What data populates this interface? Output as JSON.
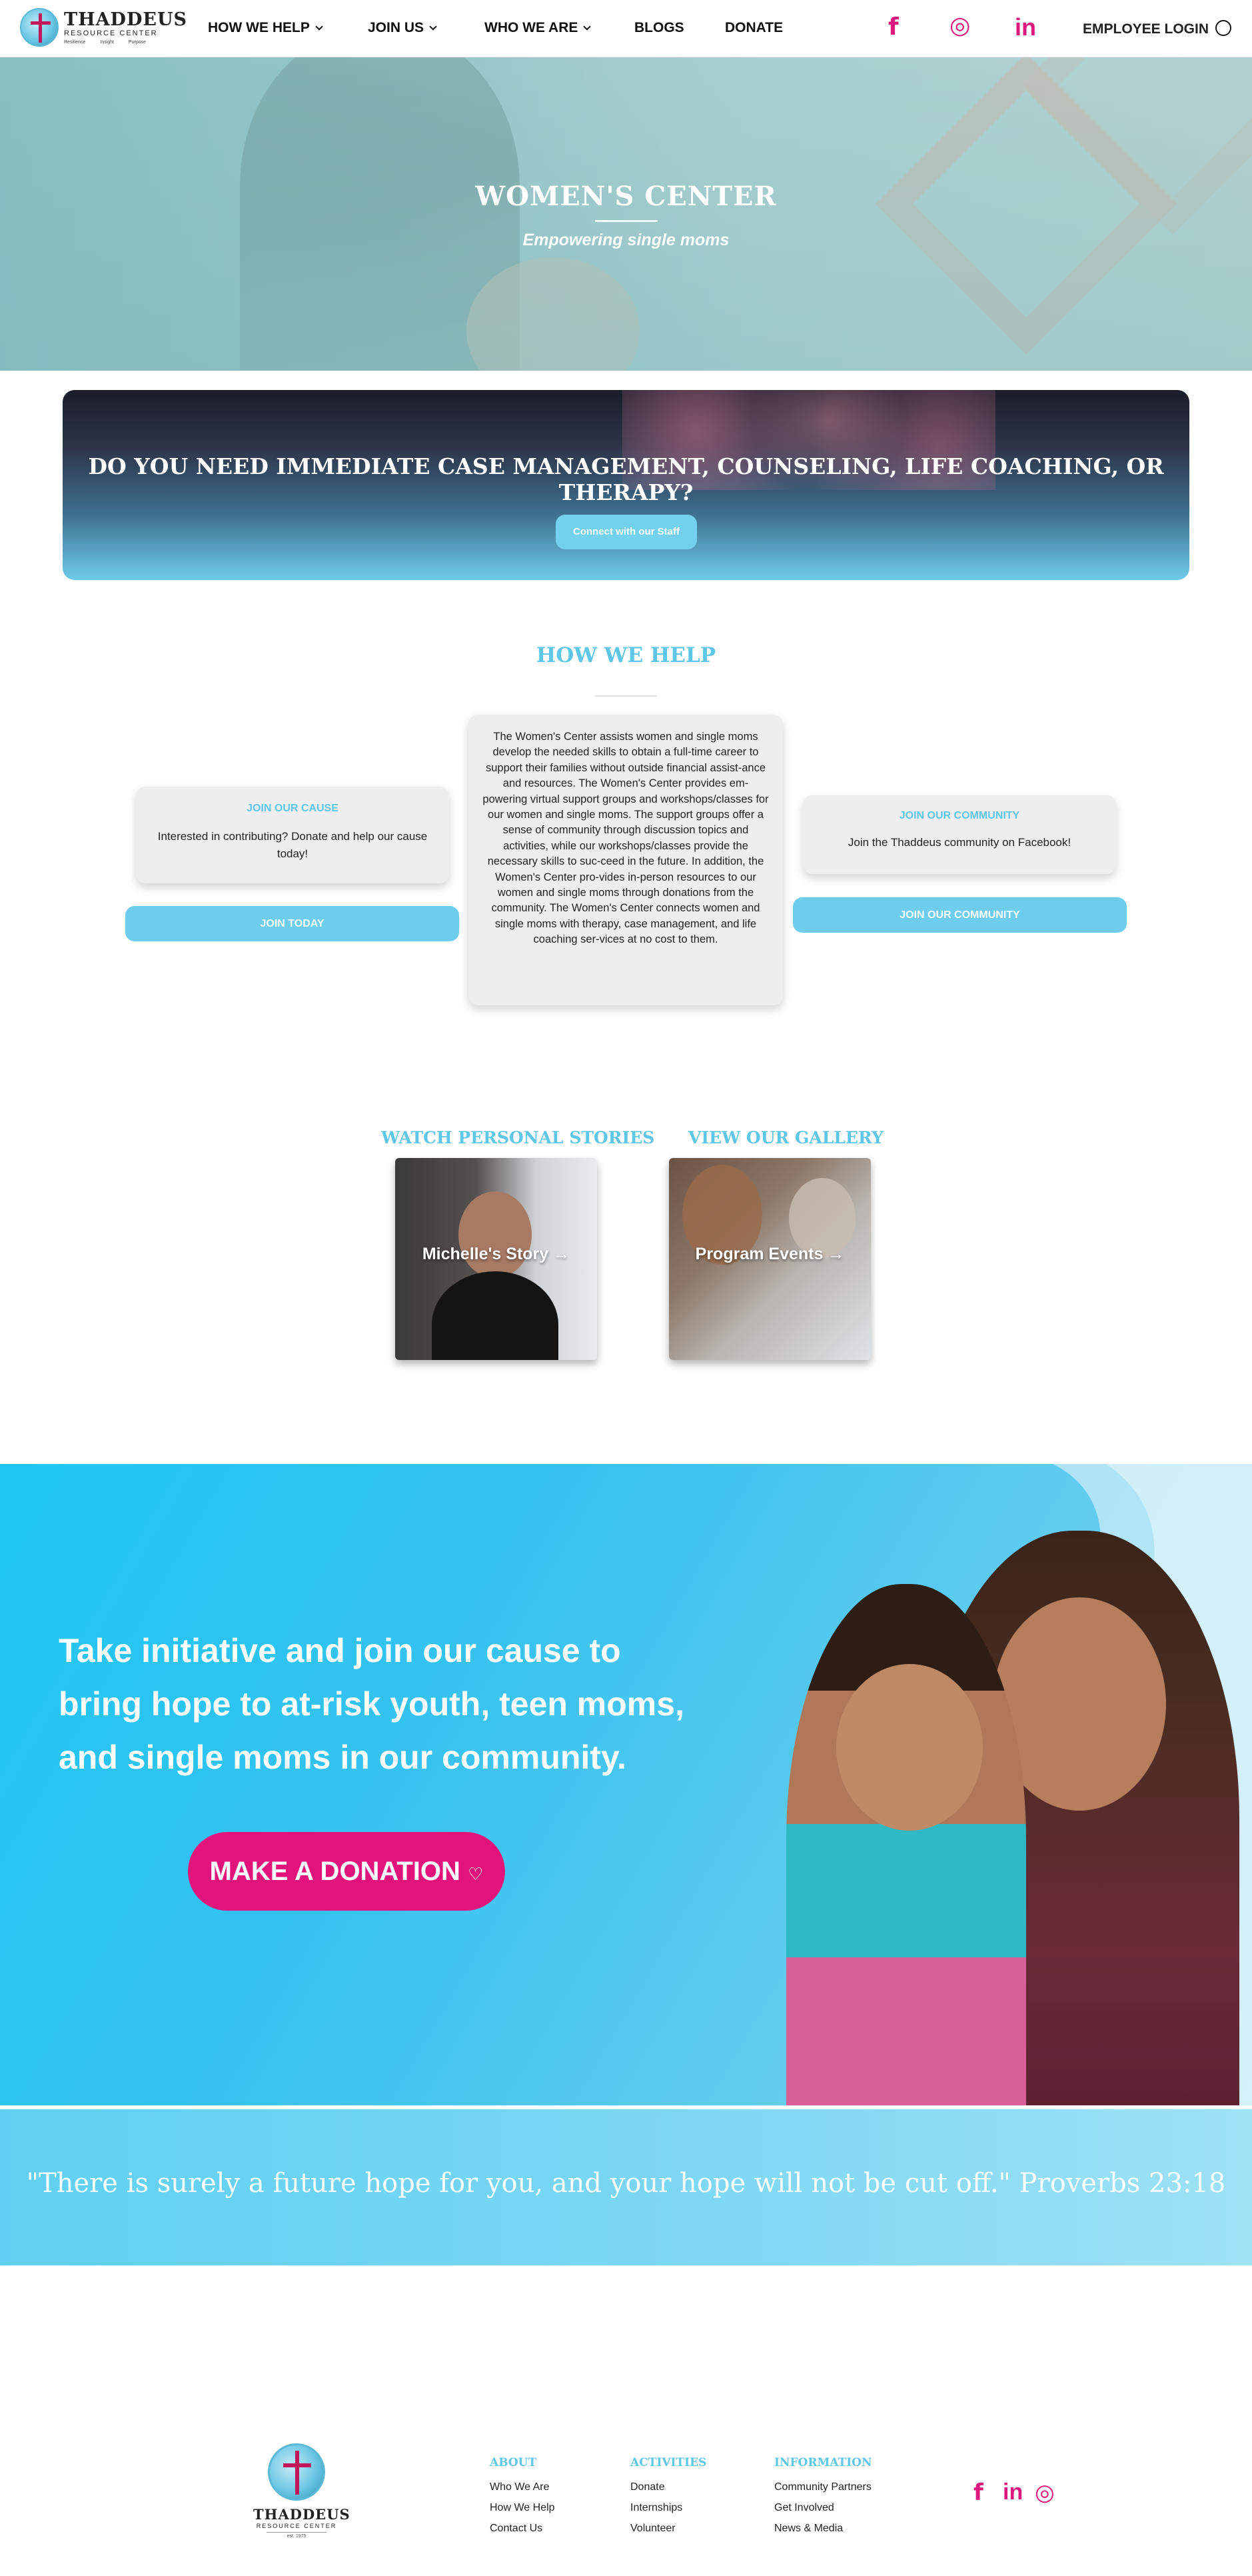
{
  "header": {
    "logo_name": "THADDEUS",
    "logo_sub": "RESOURCE CENTER",
    "logo_tags": [
      "Resilience",
      "Insight",
      "Purpose"
    ],
    "nav": [
      {
        "label": "HOW WE HELP",
        "dropdown": true
      },
      {
        "label": "JOIN US",
        "dropdown": true
      },
      {
        "label": "WHO WE ARE",
        "dropdown": true
      },
      {
        "label": "BLOGS",
        "dropdown": false
      },
      {
        "label": "DONATE",
        "dropdown": false
      }
    ],
    "social_icons": [
      "facebook-icon",
      "instagram-icon",
      "linkedin-icon"
    ],
    "social_glyphs": [
      "f",
      "◎",
      "in"
    ],
    "login_label": "EMPLOYEE LOGIN"
  },
  "hero": {
    "title": "WOMEN'S CENTER",
    "subtitle": "Empowering single moms"
  },
  "banner": {
    "heading": "DO YOU NEED IMMEDIATE CASE MANAGEMENT, COUNSELING, LIFE COACHING, OR THERAPY?",
    "button": "Connect with our Staff"
  },
  "how_we_help": {
    "title": "HOW WE HELP",
    "left_card": {
      "title": "JOIN OUR CAUSE",
      "body": "Interested in contributing? Donate and help our cause today!",
      "button": "JOIN TODAY"
    },
    "center_text": "The Women's Center assists women and single moms develop the needed skills to obtain a full-time career to support their families without outside financial assist-ance and resources. The Women's Center provides em-powering virtual support groups and workshops/classes for our women and single moms. The support groups offer a sense of community through discussion topics and activities, while our workshops/classes provide the necessary skills to suc-ceed in the future. In addition, the Women's Center pro-vides in-person resources to our women and single moms through donations from the community. The Women's Center connects women and single moms with therapy, case management, and life coaching ser-vices at no cost to them.",
    "right_card": {
      "title": "JOIN OUR COMMUNITY",
      "body": "Join the Thaddeus community on Facebook!",
      "button": "JOIN OUR COMMUNITY"
    }
  },
  "stories": {
    "left_heading": "WATCH PERSONAL STORIES",
    "right_heading": "VIEW OUR GALLERY",
    "left_tile": "Michelle's Story",
    "right_tile": "Program Events",
    "arrow": "→"
  },
  "donation": {
    "heading": "Take initiative and join our cause to bring hope to at-risk youth, teen moms, and single moms in our community.",
    "button": "MAKE A DONATION",
    "button_icon": "♡"
  },
  "quote": {
    "text": "\"There is surely a future hope for you, and your hope will not be cut off.\"  Proverbs 23:18"
  },
  "footer": {
    "logo_name": "THADDEUS",
    "logo_sub": "RESOURCE CENTER",
    "logo_est": "est. 1975",
    "columns": [
      {
        "title": "ABOUT",
        "items": [
          "Who We Are",
          "How We Help",
          "Contact Us"
        ]
      },
      {
        "title": "ACTIVITIES",
        "items": [
          "Donate",
          "Internships",
          "Volunteer"
        ]
      },
      {
        "title": "INFORMATION",
        "items": [
          "Community Partners",
          "Get Involved",
          "News & Media"
        ]
      }
    ],
    "social_glyphs": [
      "f",
      "in",
      "◎"
    ]
  },
  "colors": {
    "accent_blue": "#5ec6e6",
    "brand_pink": "#e3137c",
    "button_blue": "#6ecdec"
  }
}
